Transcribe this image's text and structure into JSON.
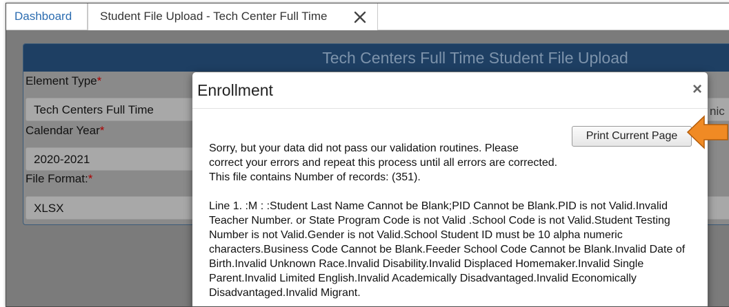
{
  "tabs": {
    "dashboard": "Dashboard",
    "active": "Student File Upload - Tech Center Full Time"
  },
  "panel": {
    "title": "Tech Centers Full Time Student File Upload",
    "element_type_label": "Element Type",
    "element_type_value": "Tech Centers Full Time",
    "calendar_year_label": "Calendar Year",
    "calendar_year_value": "2020-2021",
    "file_format_label": "File Format:",
    "file_format_value": "XLSX",
    "required_marker": "*",
    "overflow_text": "nic"
  },
  "modal": {
    "title": "Enrollment",
    "close_glyph": "×",
    "print_button": "Print Current Page",
    "message_line1": "Sorry, but your data did not pass our validation routines. Please",
    "message_line2": "correct your errors and repeat this process until all errors are corrected.",
    "message_line3": "This file contains Number of records: (351).",
    "error_text": "Line 1. :M : :Student Last Name Cannot be Blank;PID Cannot be Blank.PID is not Valid.Invalid Teacher Number. or State Program Code is not Valid .School Code is not Valid.Student Testing Number is not Valid.Gender is not Valid.School Student ID must be 10 alpha numeric characters.Business Code Cannot be Blank.Feeder School Code Cannot be Blank.Invalid Date of Birth.Invalid Unknown Race.Invalid Disability.Invalid Displaced Homemaker.Invalid Single Parent.Invalid Limited English.Invalid Academically Disadvantaged.Invalid Economically Disadvantaged.Invalid Migrant."
  },
  "colors": {
    "tab_link": "#2b6cb0",
    "panel_header": "#1e3f63",
    "arrow": "#f08a24",
    "overlay": "#7b7b7b"
  },
  "icons": {
    "tab_close": "close-icon",
    "modal_close": "close-icon",
    "annotation": "arrow-left-icon"
  }
}
